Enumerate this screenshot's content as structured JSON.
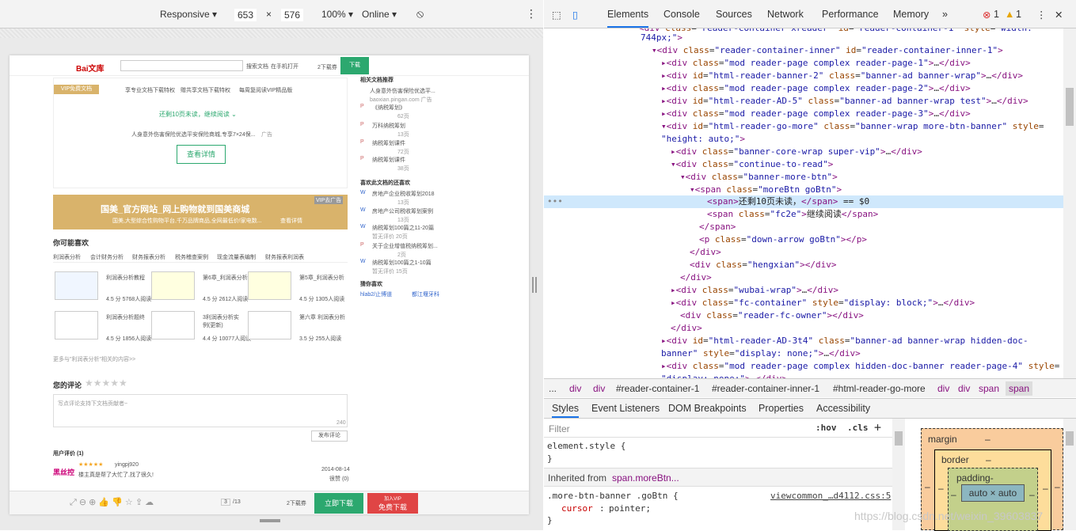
{
  "device_toolbar": {
    "mode": "Responsive",
    "width": "653",
    "x": "×",
    "height": "576",
    "zoom": "100%",
    "network": "Online"
  },
  "doc": {
    "logo": "Bai文库",
    "search_btn": "搜索文档",
    "upload": "在手机打开",
    "count": "2下载券",
    "download": "下载",
    "vip_tag": "VIP免费文档",
    "feat1": "享专业文档下载特权",
    "feat2": "赠共享文档下载特权",
    "feat3": "每周复阅读VIP精品版",
    "continue_text": "还剩10页未读，",
    "continue_link": "继续阅读",
    "ad_text": "人身意外伤害保险优选平安保险商城,专享7×24保...",
    "ad_label": "广告",
    "detail_btn": "查看详情",
    "banner_title": "国美_官方网站_网上购物就到国美商城",
    "banner_sub": "国美,大型综合性购物平台,千万品牌商品,全网最低价!家电数...",
    "banner_link": "查看详情",
    "banner_tag": "VIP去广告",
    "maybe_like": "你可能喜欢",
    "maybe_tabs": [
      "利润表分析",
      "会计财务分析",
      "财务报表分析",
      "税务稽查案例",
      "现金流量表编制",
      "财务报表利润表"
    ],
    "cards": [
      {
        "title": "利润表分析教程",
        "meta": "4.5 分 5768人阅读"
      },
      {
        "title": "第6章_利润表分析",
        "meta": "4.5 分 2612人阅读"
      },
      {
        "title": "第5章_利润表分析",
        "meta": "4.5 分 1305人阅读"
      },
      {
        "title": "利润表分析题终",
        "meta": "4.5 分 1856人阅读"
      },
      {
        "title": "3利润表分析实例(更新)",
        "meta": "4.4 分 10077人阅读"
      },
      {
        "title": "第六章 利润表分析",
        "meta": "3.5 分 255人阅读"
      }
    ],
    "more_link": "更多与\"利润表分析\"相关的内容>>",
    "comment_title": "您的评论",
    "comment_placeholder": "写点评论支持下文档贡献者~",
    "comment_count": "240",
    "comment_btn": "发布评论",
    "user_review": "用户评价",
    "user_review_count": "(1)",
    "reviewer": "yingpj920",
    "review_text": "楼主真是帮了大忙了,找了很久!",
    "review_date": "2014-08-14",
    "review_useful": "很赞 (0)",
    "reviewer_brand": "黑丝控",
    "side_title": "相关文档推荐",
    "side_items": [
      {
        "t": "人身意外伤害保险优选平...",
        "s": "baoxian.pingan.com  广告"
      },
      {
        "t": "《纳税筹划》",
        "s": "62页"
      },
      {
        "t": "万科纳税筹划",
        "s": "13页"
      },
      {
        "t": "纳税筹划课件",
        "s": "72页"
      },
      {
        "t": "纳税筹划课件",
        "s": "38页"
      }
    ],
    "side_title2": "喜欢此文档的还喜欢",
    "side_items2": [
      {
        "t": "房地产企业税收筹划2018",
        "s": "13页"
      },
      {
        "t": "房地产公司税收筹划案例",
        "s": "13页"
      },
      {
        "t": "纳税筹划100篇之11-20篇",
        "s": "暂无评价  20页"
      },
      {
        "t": "关于企业增值税纳税筹划...",
        "s": "2页"
      },
      {
        "t": "纳税筹划100篇之1-10篇",
        "s": "暂无评价  15页"
      }
    ],
    "side_title3": "猜你喜欢",
    "side_link1": "hlab2/止博道",
    "side_link2": "都江堰牙科",
    "bottom_page": "3",
    "bottom_total": "/13",
    "bottom_count": "2下载券",
    "bottom_dl": "立即下载",
    "bottom_vip_top": "加入VIP",
    "bottom_vip": "免费下载"
  },
  "devtools": {
    "tabs": [
      "Elements",
      "Console",
      "Sources",
      "Network",
      "Performance",
      "Memory"
    ],
    "more": "»",
    "errors": "1",
    "warnings": "1",
    "crumbs": [
      "...",
      "div",
      "div",
      "#reader-container-1",
      "#reader-container-inner-1",
      "#html-reader-go-more",
      "div",
      "div",
      "span",
      "span"
    ],
    "subtabs": [
      "Styles",
      "Event Listeners",
      "DOM Breakpoints",
      "Properties",
      "Accessibility"
    ],
    "filter": "Filter",
    "hov": ":hov",
    "cls": ".cls",
    "plus": "+",
    "rule1": "element.style {",
    "rule1_close": "}",
    "inherited": "Inherited from",
    "inherited_el": "span.moreBtn...",
    "rule2_sel": ".more-btn-banner .goBtn {",
    "rule2_src": "viewcommon_…d4112.css:5",
    "rule2_prop": "cursor",
    "rule2_val": "pointer;",
    "rule2_close": "}",
    "bm_margin": "margin",
    "bm_border": "border",
    "bm_padding": "padding-",
    "bm_content": "auto × auto",
    "dash": "–",
    "watermark": "https://blog.csdn.net/weixin_39603837"
  }
}
